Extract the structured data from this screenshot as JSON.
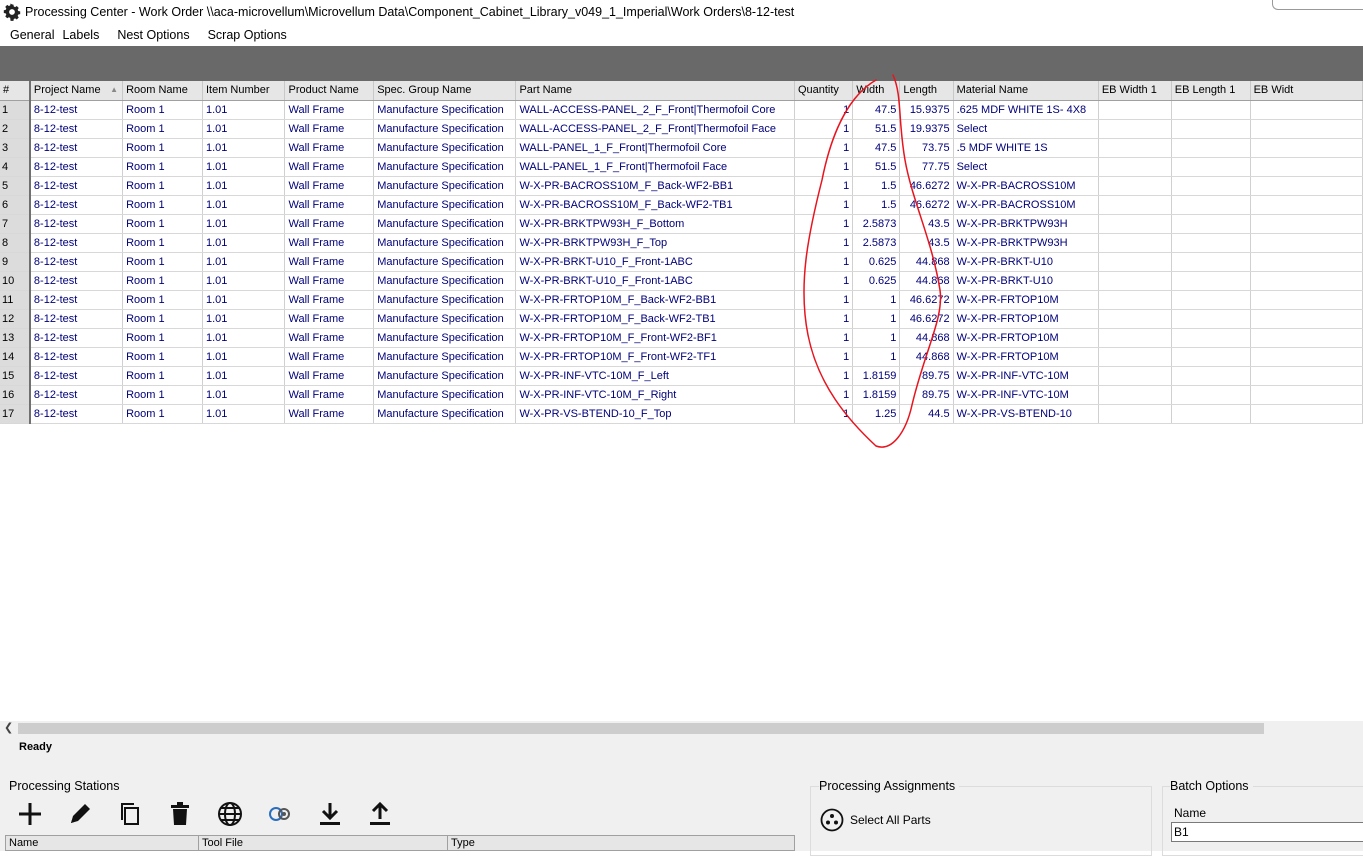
{
  "window": {
    "title": "Processing Center - Work Order \\\\aca-microvellum\\Microvellum Data\\Component_Cabinet_Library_v049_1_Imperial\\Work Orders\\8-12-test"
  },
  "menu": [
    "General",
    "Labels",
    "Nest Options",
    "Scrap Options"
  ],
  "grid": {
    "columns": [
      "#",
      "Project Name",
      "Room Name",
      "Item Number",
      "Product Name",
      "Spec. Group Name",
      "Part Name",
      "Quantity",
      "Width",
      "Length",
      "Material Name",
      "EB Width 1",
      "EB Length 1",
      "EB Widt"
    ],
    "rows": [
      [
        "1",
        "8-12-test",
        "Room 1",
        "1.01",
        "Wall Frame",
        "Manufacture Specification",
        "WALL-ACCESS-PANEL_2_F_Front|Thermofoil Core",
        "1",
        "47.5",
        "15.9375",
        ".625 MDF WHITE 1S- 4X8",
        "",
        "",
        ""
      ],
      [
        "2",
        "8-12-test",
        "Room 1",
        "1.01",
        "Wall Frame",
        "Manufacture Specification",
        "WALL-ACCESS-PANEL_2_F_Front|Thermofoil Face",
        "1",
        "51.5",
        "19.9375",
        "Select",
        "",
        "",
        ""
      ],
      [
        "3",
        "8-12-test",
        "Room 1",
        "1.01",
        "Wall Frame",
        "Manufacture Specification",
        "WALL-PANEL_1_F_Front|Thermofoil Core",
        "1",
        "47.5",
        "73.75",
        ".5 MDF WHITE 1S",
        "",
        "",
        ""
      ],
      [
        "4",
        "8-12-test",
        "Room 1",
        "1.01",
        "Wall Frame",
        "Manufacture Specification",
        "WALL-PANEL_1_F_Front|Thermofoil Face",
        "1",
        "51.5",
        "77.75",
        "Select",
        "",
        "",
        ""
      ],
      [
        "5",
        "8-12-test",
        "Room 1",
        "1.01",
        "Wall Frame",
        "Manufacture Specification",
        "W-X-PR-BACROSS10M_F_Back-WF2-BB1",
        "1",
        "1.5",
        "46.6272",
        "W-X-PR-BACROSS10M",
        "",
        "",
        ""
      ],
      [
        "6",
        "8-12-test",
        "Room 1",
        "1.01",
        "Wall Frame",
        "Manufacture Specification",
        "W-X-PR-BACROSS10M_F_Back-WF2-TB1",
        "1",
        "1.5",
        "46.6272",
        "W-X-PR-BACROSS10M",
        "",
        "",
        ""
      ],
      [
        "7",
        "8-12-test",
        "Room 1",
        "1.01",
        "Wall Frame",
        "Manufacture Specification",
        "W-X-PR-BRKTPW93H_F_Bottom",
        "1",
        "2.5873",
        "43.5",
        "W-X-PR-BRKTPW93H",
        "",
        "",
        ""
      ],
      [
        "8",
        "8-12-test",
        "Room 1",
        "1.01",
        "Wall Frame",
        "Manufacture Specification",
        "W-X-PR-BRKTPW93H_F_Top",
        "1",
        "2.5873",
        "43.5",
        "W-X-PR-BRKTPW93H",
        "",
        "",
        ""
      ],
      [
        "9",
        "8-12-test",
        "Room 1",
        "1.01",
        "Wall Frame",
        "Manufacture Specification",
        "W-X-PR-BRKT-U10_F_Front-1ABC",
        "1",
        "0.625",
        "44.868",
        "W-X-PR-BRKT-U10",
        "",
        "",
        ""
      ],
      [
        "10",
        "8-12-test",
        "Room 1",
        "1.01",
        "Wall Frame",
        "Manufacture Specification",
        "W-X-PR-BRKT-U10_F_Front-1ABC",
        "1",
        "0.625",
        "44.868",
        "W-X-PR-BRKT-U10",
        "",
        "",
        ""
      ],
      [
        "11",
        "8-12-test",
        "Room 1",
        "1.01",
        "Wall Frame",
        "Manufacture Specification",
        "W-X-PR-FRTOP10M_F_Back-WF2-BB1",
        "1",
        "1",
        "46.6272",
        "W-X-PR-FRTOP10M",
        "",
        "",
        ""
      ],
      [
        "12",
        "8-12-test",
        "Room 1",
        "1.01",
        "Wall Frame",
        "Manufacture Specification",
        "W-X-PR-FRTOP10M_F_Back-WF2-TB1",
        "1",
        "1",
        "46.6272",
        "W-X-PR-FRTOP10M",
        "",
        "",
        ""
      ],
      [
        "13",
        "8-12-test",
        "Room 1",
        "1.01",
        "Wall Frame",
        "Manufacture Specification",
        "W-X-PR-FRTOP10M_F_Front-WF2-BF1",
        "1",
        "1",
        "44.868",
        "W-X-PR-FRTOP10M",
        "",
        "",
        ""
      ],
      [
        "14",
        "8-12-test",
        "Room 1",
        "1.01",
        "Wall Frame",
        "Manufacture Specification",
        "W-X-PR-FRTOP10M_F_Front-WF2-TF1",
        "1",
        "1",
        "44.868",
        "W-X-PR-FRTOP10M",
        "",
        "",
        ""
      ],
      [
        "15",
        "8-12-test",
        "Room 1",
        "1.01",
        "Wall Frame",
        "Manufacture Specification",
        "W-X-PR-INF-VTC-10M_F_Left",
        "1",
        "1.8159",
        "89.75",
        "W-X-PR-INF-VTC-10M",
        "",
        "",
        ""
      ],
      [
        "16",
        "8-12-test",
        "Room 1",
        "1.01",
        "Wall Frame",
        "Manufacture Specification",
        "W-X-PR-INF-VTC-10M_F_Right",
        "1",
        "1.8159",
        "89.75",
        "W-X-PR-INF-VTC-10M",
        "",
        "",
        ""
      ],
      [
        "17",
        "8-12-test",
        "Room 1",
        "1.01",
        "Wall Frame",
        "Manufacture Specification",
        "W-X-PR-VS-BTEND-10_F_Top",
        "1",
        "1.25",
        "44.5",
        "W-X-PR-VS-BTEND-10",
        "",
        "",
        ""
      ]
    ]
  },
  "status": {
    "text": "Ready"
  },
  "stations": {
    "title": "Processing Stations",
    "toolbar_icons": [
      "add-icon",
      "edit-icon",
      "copy-icon",
      "delete-icon",
      "globe-icon",
      "sync-icon",
      "download-icon",
      "upload-icon"
    ],
    "columns": [
      "Name",
      "Tool File",
      "Type"
    ]
  },
  "assignments": {
    "title": "Processing Assignments",
    "select_all_label": "Select All Parts"
  },
  "batch": {
    "title": "Batch Options",
    "name_label": "Name",
    "name_value": "B1"
  },
  "annotation_color": "#e8141e"
}
